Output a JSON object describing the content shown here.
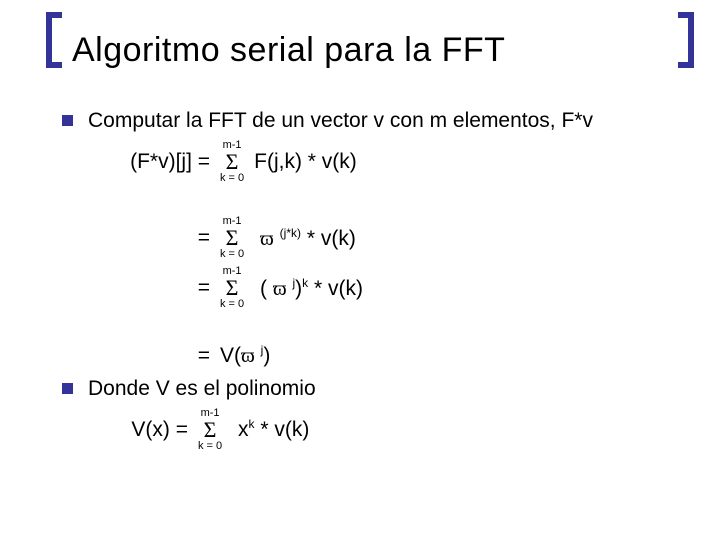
{
  "title": "Algoritmo serial para la FFT",
  "bullet1": "Computar la FFT de un vector v con m elementos, F*v",
  "eq1": {
    "lhs": "(F*v)[j] =",
    "sum_upper": "m-1",
    "sum_lower": "k = 0",
    "rhs": "F(j,k) * v(k)"
  },
  "eq2": {
    "lhs": "=",
    "sum_upper": "m-1",
    "sum_lower": "k = 0",
    "omega_exp": "(j*k)",
    "tail": " * v(k)"
  },
  "eq3": {
    "lhs": "=",
    "sum_upper": "m-1",
    "sum_lower": "k = 0",
    "omega_exp_inner": "j",
    "outer_exp": "k",
    "tail": " * v(k)"
  },
  "eq4": {
    "lhs": "=",
    "pre": "V(",
    "omega_exp": "j",
    "post": ")"
  },
  "bullet2": "Donde V es el polinomio",
  "eq5": {
    "lhs": "V(x) =",
    "sum_upper": "m-1",
    "sum_lower": "k = 0",
    "rhs_pre": "x",
    "rhs_exp": "k",
    "rhs_post": " * v(k)"
  }
}
